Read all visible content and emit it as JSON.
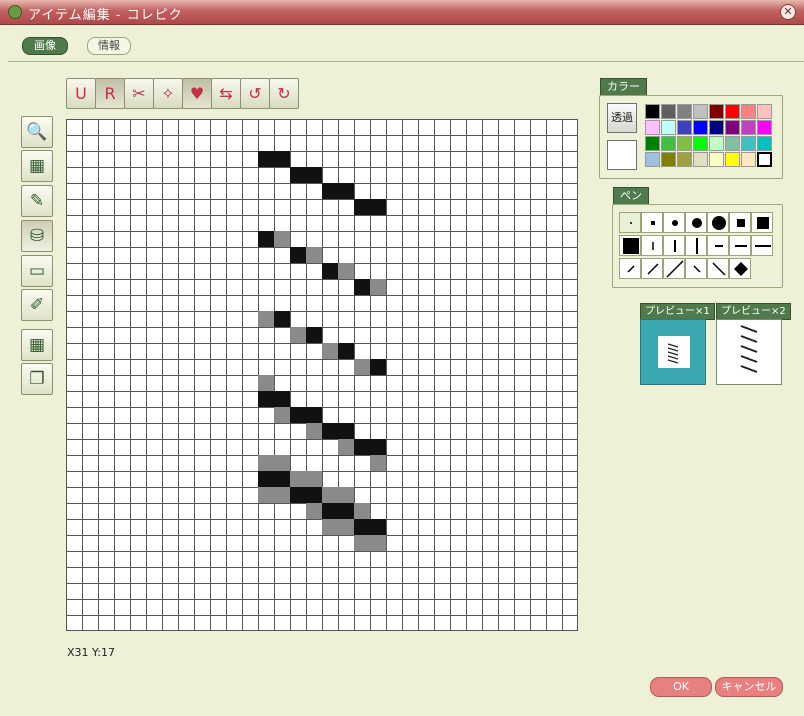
{
  "window": {
    "title": "アイテム編集 - コレピク",
    "close_glyph": "✕"
  },
  "tabs": [
    {
      "label": "画像",
      "active": true
    },
    {
      "label": "情報",
      "active": false
    }
  ],
  "toolbar": {
    "buttons": [
      {
        "name": "undo-button",
        "glyph": "U",
        "icon": "undo-icon"
      },
      {
        "name": "redo-button",
        "glyph": "R",
        "icon": "redo-icon"
      },
      {
        "name": "cut-button",
        "glyph": "✂",
        "icon": "scissors-icon"
      },
      {
        "name": "sparkle-button",
        "glyph": "✧",
        "icon": "sparkle-heart-icon"
      },
      {
        "name": "heart-button",
        "glyph": "♥",
        "icon": "heart-icon"
      },
      {
        "name": "flip-button",
        "glyph": "⇆",
        "icon": "flip-icon"
      },
      {
        "name": "rotate-left-button",
        "glyph": "↺",
        "icon": "rotate-left-icon"
      },
      {
        "name": "rotate-right-button",
        "glyph": "↻",
        "icon": "rotate-right-icon"
      }
    ]
  },
  "left_tools": [
    {
      "name": "zoom-tool",
      "icon": "magnifier-icon",
      "glyph": "🔍"
    },
    {
      "name": "select-tool",
      "icon": "selection-icon",
      "glyph": "▦"
    },
    {
      "name": "pencil-tool",
      "icon": "pencil-icon",
      "glyph": "✎"
    },
    {
      "name": "fill-tool",
      "icon": "bucket-icon",
      "glyph": "⛁"
    },
    {
      "name": "eraser-tool",
      "icon": "eraser-icon",
      "glyph": "▭"
    },
    {
      "name": "eyedropper-tool",
      "icon": "eyedropper-icon",
      "glyph": "✐"
    },
    {
      "name": "grid-toggle",
      "icon": "grid-icon",
      "glyph": "▦"
    },
    {
      "name": "layer-toggle",
      "icon": "layers-icon",
      "glyph": "❐"
    }
  ],
  "canvas": {
    "status": "X31 Y:17",
    "dark_color": "#111111",
    "gray_color": "#8a8a8a",
    "dark_cells": [
      [
        12,
        2
      ],
      [
        13,
        2
      ],
      [
        14,
        3
      ],
      [
        15,
        3
      ],
      [
        16,
        4
      ],
      [
        17,
        4
      ],
      [
        18,
        5
      ],
      [
        19,
        5
      ],
      [
        12,
        7
      ],
      [
        14,
        8
      ],
      [
        16,
        9
      ],
      [
        18,
        10
      ],
      [
        13,
        12
      ],
      [
        15,
        13
      ],
      [
        17,
        14
      ],
      [
        19,
        15
      ],
      [
        12,
        17
      ],
      [
        13,
        17
      ],
      [
        14,
        18
      ],
      [
        15,
        18
      ],
      [
        16,
        19
      ],
      [
        17,
        19
      ],
      [
        18,
        20
      ],
      [
        19,
        20
      ],
      [
        12,
        22
      ],
      [
        13,
        22
      ],
      [
        14,
        23
      ],
      [
        15,
        23
      ],
      [
        16,
        24
      ],
      [
        17,
        24
      ],
      [
        18,
        25
      ],
      [
        19,
        25
      ]
    ],
    "gray_cells": [
      [
        13,
        7
      ],
      [
        15,
        8
      ],
      [
        17,
        9
      ],
      [
        19,
        10
      ],
      [
        12,
        12
      ],
      [
        14,
        13
      ],
      [
        16,
        14
      ],
      [
        18,
        15
      ],
      [
        12,
        16
      ],
      [
        13,
        18
      ],
      [
        15,
        19
      ],
      [
        17,
        20
      ],
      [
        19,
        21
      ],
      [
        12,
        21
      ],
      [
        13,
        21
      ],
      [
        14,
        22
      ],
      [
        15,
        22
      ],
      [
        16,
        23
      ],
      [
        17,
        23
      ],
      [
        18,
        24
      ],
      [
        19,
        26
      ],
      [
        12,
        23
      ],
      [
        13,
        23
      ],
      [
        15,
        24
      ],
      [
        16,
        25
      ],
      [
        17,
        25
      ],
      [
        18,
        26
      ]
    ]
  },
  "color_panel": {
    "label": "カラー",
    "transparent_label": "透過",
    "palette": [
      "#000000",
      "#606060",
      "#808080",
      "#c0c0c0",
      "#800000",
      "#ff0000",
      "#ff8080",
      "#ffc0c0",
      "#ffc0ff",
      "#c0ffff",
      "#4040c0",
      "#0000ff",
      "#000080",
      "#800080",
      "#c040c0",
      "#ff00ff",
      "#008000",
      "#40c040",
      "#80c040",
      "#00ff00",
      "#c0ffc0",
      "#80c0a0",
      "#40c0c0",
      "#00c0c0",
      "#a0c0e0",
      "#808000",
      "#a0a040",
      "#e0e0c0",
      "#ffffc0",
      "#ffff00",
      "#ffe8c0",
      "#ffffff"
    ],
    "selected_index": 31
  },
  "pen_panel": {
    "label": "ペン"
  },
  "previews": {
    "x1_label": "プレビュー×1",
    "x2_label": "プレビュー×2"
  },
  "buttons": {
    "ok": "OK",
    "cancel": "キャンセル"
  }
}
